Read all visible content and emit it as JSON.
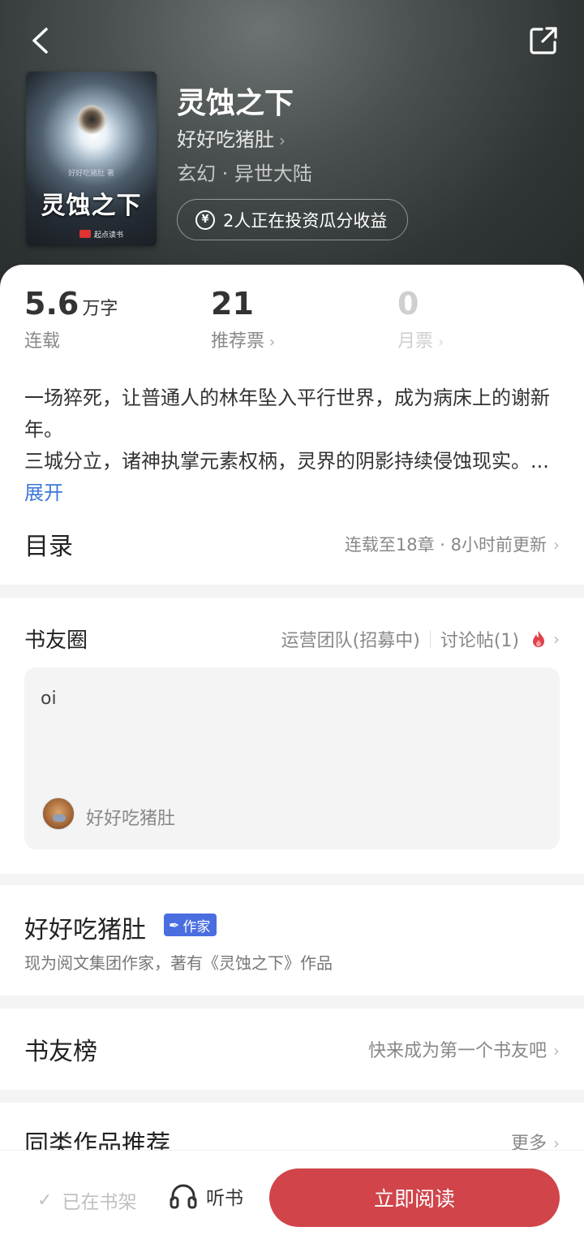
{
  "book": {
    "title": "灵蚀之下",
    "author": "好好吃猪肚",
    "genre": "玄幻 · 异世大陆",
    "invest_text": "2人正在投资瓜分收益"
  },
  "cover": {
    "title": "灵蚀之下",
    "author_line": "好好吃猪肚 著",
    "brand": "起点读书"
  },
  "stats": {
    "words": {
      "value": "5.6",
      "unit": "万字",
      "label": "连载"
    },
    "recommend": {
      "value": "21",
      "label": "推荐票"
    },
    "monthly": {
      "value": "0",
      "label": "月票"
    }
  },
  "synopsis": {
    "line1": "一场猝死，让普通人的林年坠入平行世界，成为病床上的谢新年。",
    "line2": "三城分立，诸神执掌元素权柄，灵界的阴影持续侵蚀现实。...",
    "expand_label": "展开"
  },
  "toc": {
    "title": "目录",
    "info": "连载至18章 · 8小时前更新"
  },
  "circle": {
    "title": "书友圈",
    "ops_team": "运营团队(招募中)",
    "discussion": "讨论帖(1)",
    "post": {
      "text": "oi",
      "author": "好好吃猪肚"
    }
  },
  "author_section": {
    "name": "好好吃猪肚",
    "badge": "作家",
    "description": "现为阅文集团作家，著有《灵蚀之下》作品"
  },
  "rank": {
    "title": "书友榜",
    "info": "快来成为第一个书友吧"
  },
  "similar": {
    "title": "同类作品推荐",
    "more": "更多"
  },
  "bottom_bar": {
    "shelf": "已在书架",
    "listen": "听书",
    "read": "立即阅读"
  },
  "colors": {
    "accent_red": "#d0444a",
    "link_blue": "#3d78d8",
    "badge_blue": "#4a6ee0",
    "fire_red": "#e0414a"
  },
  "icons": {
    "back": "back-arrow-icon",
    "share": "share-icon",
    "yen": "yen-icon",
    "fire": "fire-icon",
    "quill": "quill-icon",
    "headphones": "headphones-icon",
    "check": "check-icon"
  }
}
